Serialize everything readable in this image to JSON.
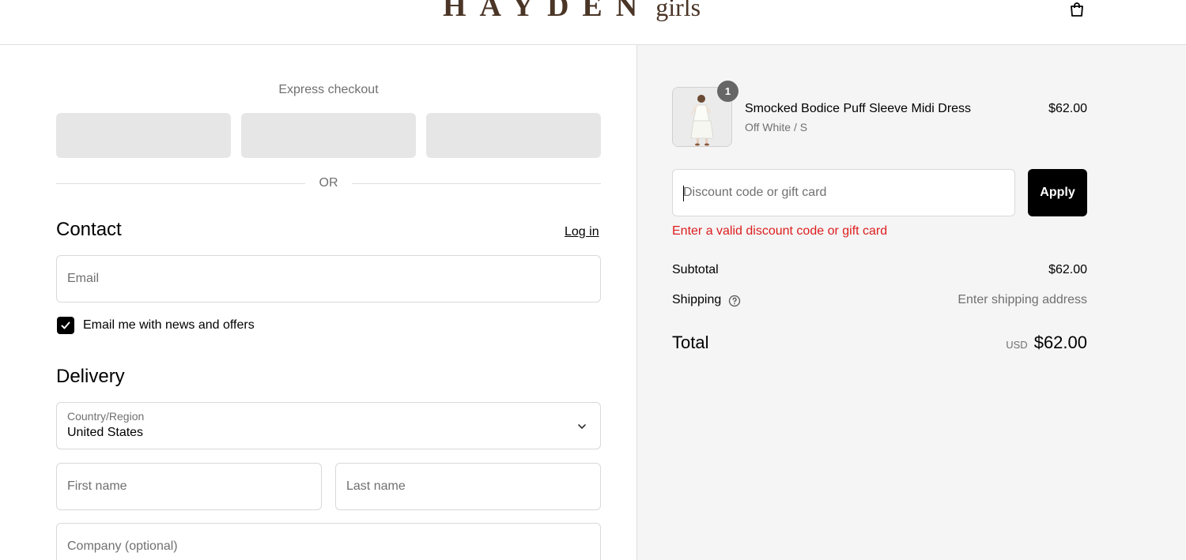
{
  "header": {
    "logo_main": "HAYDEN",
    "logo_sub": "girls"
  },
  "express": {
    "title": "Express checkout",
    "divider": "OR"
  },
  "contact": {
    "title": "Contact",
    "login_link": "Log in",
    "email_placeholder": "Email",
    "newsletter_label": "Email me with news and offers",
    "newsletter_checked": true
  },
  "delivery": {
    "title": "Delivery",
    "country_label": "Country/Region",
    "country_value": "United States",
    "first_name_placeholder": "First name",
    "last_name_placeholder": "Last name",
    "company_placeholder": "Company (optional)"
  },
  "order": {
    "item": {
      "quantity": "1",
      "name": "Smocked Bodice Puff Sleeve Midi Dress",
      "variant": "Off White / S",
      "price": "$62.00"
    },
    "discount_placeholder": "Discount code or gift card",
    "apply_label": "Apply",
    "discount_error": "Enter a valid discount code or gift card",
    "subtotal_label": "Subtotal",
    "subtotal_value": "$62.00",
    "shipping_label": "Shipping",
    "shipping_value": "Enter shipping address",
    "total_label": "Total",
    "total_currency": "USD",
    "total_value": "$62.00"
  },
  "colors": {
    "brand": "#4a3526",
    "error": "#dd1d1d",
    "button": "#000000",
    "summary_bg": "#f5f5f5"
  }
}
